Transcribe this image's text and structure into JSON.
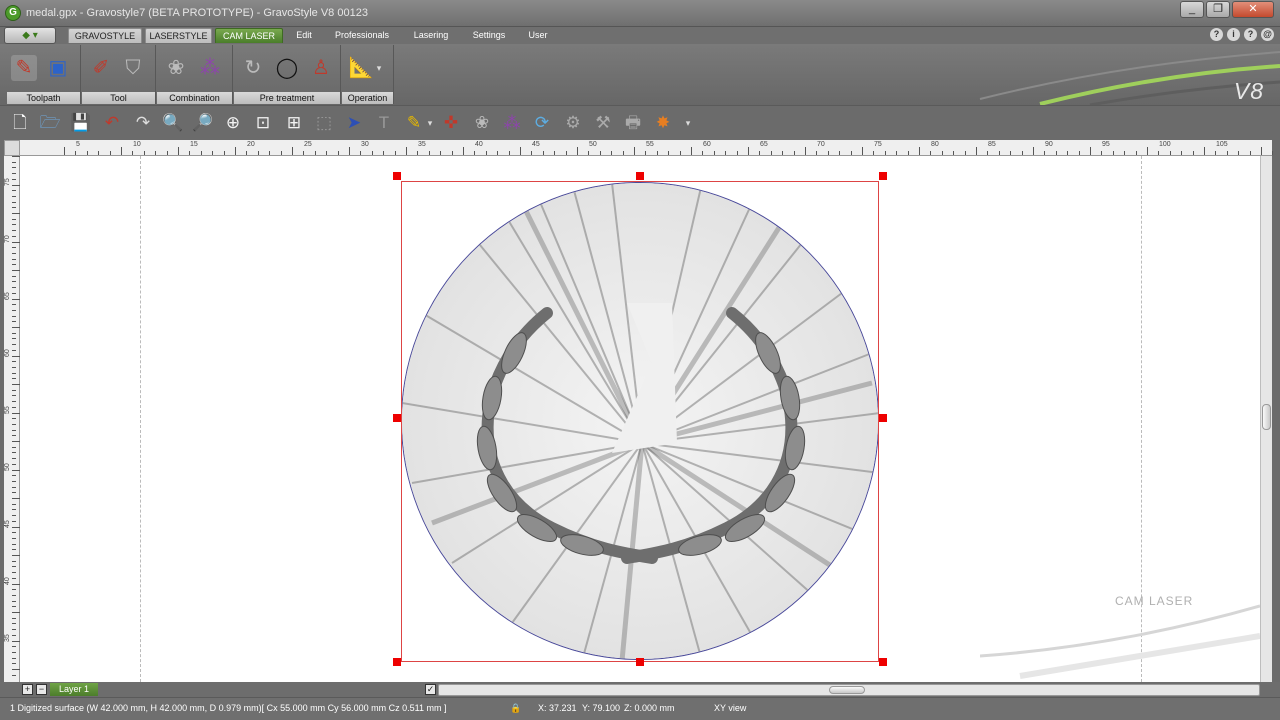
{
  "window": {
    "title": "medal.gpx - Gravostyle7 (BETA PROTOTYPE) - GravoStyle V8 00123",
    "app_icon": "gravostyle-icon",
    "buttons": [
      "_",
      "❐",
      "✕"
    ]
  },
  "menubar": {
    "items": [
      "GRAVOSTYLE",
      "LASERSTYLE",
      "CAM LASER",
      "Edit",
      "Professionals",
      "Lasering",
      "Settings",
      "User"
    ],
    "active": "CAM LASER",
    "right_icons": [
      "?",
      "i",
      "?",
      "@"
    ]
  },
  "ribbon": {
    "groups": [
      "Toolpath",
      "Tool",
      "Combination",
      "Pre treatment",
      "Operation"
    ],
    "brand": "V8"
  },
  "ruler": {
    "h_labels": [
      "5",
      "10",
      "15",
      "20",
      "25",
      "30",
      "35",
      "40",
      "45",
      "50",
      "55",
      "60",
      "65",
      "70",
      "75",
      "80",
      "85",
      "90",
      "95",
      "100",
      "105"
    ],
    "v_labels": [
      "75",
      "70",
      "65",
      "60",
      "55",
      "50",
      "45",
      "40",
      "35"
    ]
  },
  "canvas": {
    "watermark": "CAM LASER"
  },
  "layers": {
    "add": "+",
    "remove": "−",
    "current": "Layer 1"
  },
  "status": {
    "selection": "1 Digitized surface (W 42.000 mm, H 42.000 mm, D 0.979 mm)[ Cx 55.000 mm  Cy 56.000 mm  Cz 0.511 mm ]",
    "x": "X: 37.231",
    "y": "Y: 79.100",
    "z": "Z: 0.000 mm",
    "view": "XY view"
  },
  "colors": {
    "accent_green": "#4a7d2a",
    "selection_red": "#e00000"
  }
}
